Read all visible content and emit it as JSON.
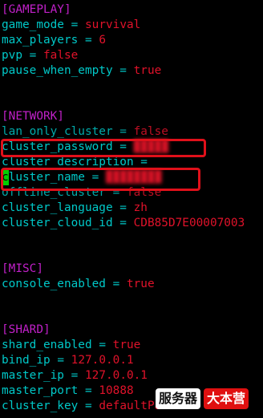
{
  "gameplay": {
    "header": "[GAMEPLAY]",
    "game_mode": {
      "key": "game_mode",
      "op": "=",
      "value": "survival"
    },
    "max_players": {
      "key": "max_players",
      "op": "=",
      "value": "6"
    },
    "pvp": {
      "key": "pvp",
      "op": "=",
      "value": "false"
    },
    "pause_when_empty": {
      "key": "pause_when_empty",
      "op": "=",
      "value": "true"
    }
  },
  "network": {
    "header": "[NETWORK]",
    "lan_only_cluster": {
      "key": "lan_only_cluster",
      "op": "=",
      "value": "false"
    },
    "cluster_password": {
      "key": "cluster_password",
      "op": "=",
      "value": "█████"
    },
    "cluster_description": {
      "key": "cluster_description",
      "op": "=",
      "value": ""
    },
    "cluster_name": {
      "cursor_char": "c",
      "key_rest": "luster_name",
      "op": "=",
      "value": "████████"
    },
    "offline_cluster": {
      "key": "offline_cluster",
      "op": "=",
      "value": "false"
    },
    "cluster_language": {
      "key": "cluster_language",
      "op": "=",
      "value": "zh"
    },
    "cluster_cloud_id": {
      "key": "cluster_cloud_id",
      "op": "=",
      "value": "CDB85D7E00007003"
    }
  },
  "misc": {
    "header": "[MISC]",
    "console_enabled": {
      "key": "console_enabled",
      "op": "=",
      "value": "true"
    }
  },
  "shard": {
    "header": "[SHARD]",
    "shard_enabled": {
      "key": "shard_enabled",
      "op": "=",
      "value": "true"
    },
    "bind_ip": {
      "key": "bind_ip",
      "op": "=",
      "value": "127.0.0.1"
    },
    "master_ip": {
      "key": "master_ip",
      "op": "=",
      "value": "127.0.0.1"
    },
    "master_port": {
      "key": "master_port",
      "op": "=",
      "value": "10888"
    },
    "cluster_key": {
      "key": "cluster_key",
      "op": "=",
      "value": "defaultPass"
    }
  },
  "watermark": {
    "part1": "服务器",
    "part2": "大本营"
  },
  "colors": {
    "background": "#000000",
    "section": "#c020c8",
    "key": "#00c8c8",
    "value": "#e0122a",
    "cursor": "#00d000",
    "highlight": "#e0101a"
  }
}
